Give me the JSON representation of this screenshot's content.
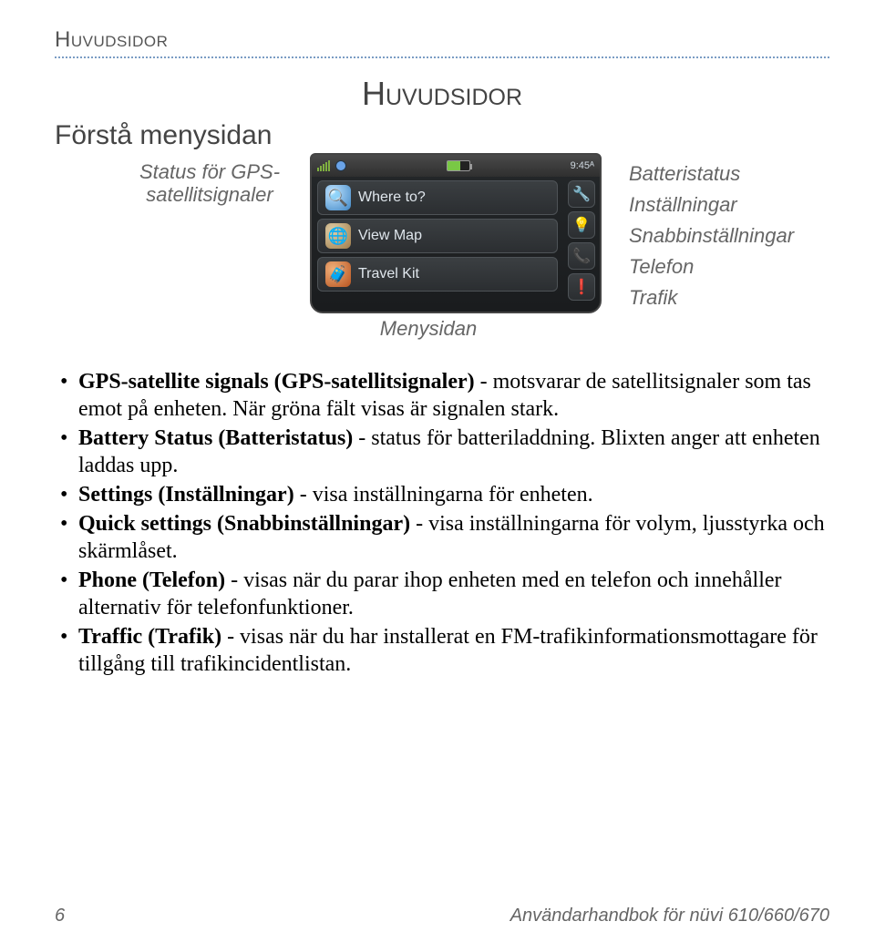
{
  "header": {
    "title": "Huvudsidor"
  },
  "main_heading": "Huvudsidor",
  "subheading": "Förstå menysidan",
  "diagram": {
    "left_label_line1": "Status för GPS-",
    "left_label_line2": "satellitsignaler",
    "right_labels": {
      "batteristatus": "Batteristatus",
      "installningar": "Inställningar",
      "snabb": "Snabbinställningar",
      "telefon": "Telefon",
      "trafik": "Trafik"
    },
    "menysidan": "Menysidan",
    "device": {
      "time": "9:45ᴬ",
      "menu": {
        "where": "Where to?",
        "map": "View Map",
        "kit": "Travel Kit"
      }
    }
  },
  "bullets": {
    "b1": {
      "bold": "GPS-satellite signals (GPS-satellitsignaler)",
      "rest": " - motsvarar de satellitsignaler som tas emot på enheten. När gröna fält visas är signalen stark."
    },
    "b2": {
      "bold": "Battery Status (Batteristatus)",
      "rest": " - status för batteriladdning. Blixten anger att enheten laddas upp."
    },
    "b3": {
      "bold": "Settings (Inställningar)",
      "rest": " - visa inställningarna för enheten."
    },
    "b4": {
      "bold": "Quick settings (Snabbinställningar)",
      "rest": " - visa inställningarna för volym, ljusstyrka och skärmlåset."
    },
    "b5": {
      "bold": "Phone (Telefon)",
      "rest": " - visas när du parar ihop enheten med en telefon och innehåller alternativ för telefonfunktioner."
    },
    "b6": {
      "bold": "Traffic (Trafik)",
      "rest": " - visas när du har installerat en FM-trafikinformationsmottagare för tillgång till trafikincidentlistan."
    }
  },
  "footer": {
    "page": "6",
    "doc": "Användarhandbok för nüvi 610/660/670"
  }
}
